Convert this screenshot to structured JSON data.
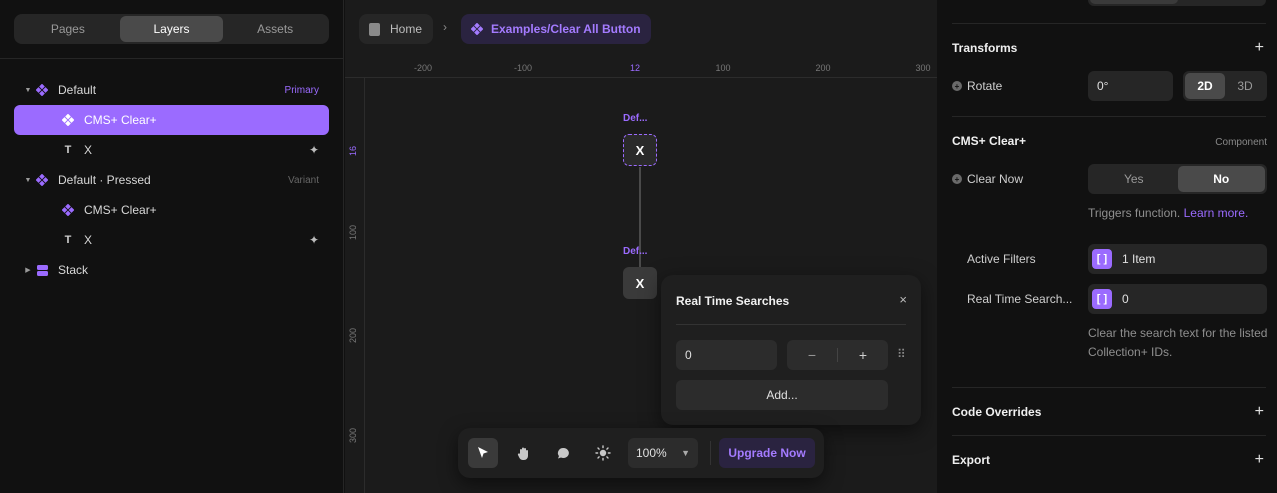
{
  "left_panel": {
    "tabs": [
      "Pages",
      "Layers",
      "Assets"
    ],
    "active_tab": "Layers",
    "layers": [
      {
        "label": "Default",
        "tag": "Primary"
      },
      {
        "label": "CMS+ Clear+"
      },
      {
        "label": "X"
      },
      {
        "label": "Default · Pressed",
        "tag": "Variant"
      },
      {
        "label": "CMS+ Clear+"
      },
      {
        "label": "X"
      },
      {
        "label": "Stack"
      }
    ]
  },
  "breadcrumb": {
    "home": "Home",
    "current": "Examples/Clear All Button"
  },
  "canvas": {
    "ruler_x": [
      "-200",
      "-100",
      "12",
      "100",
      "200",
      "300"
    ],
    "ruler_y": [
      "16",
      "100",
      "200",
      "300"
    ],
    "frame_label_1": "Def...",
    "frame_label_2": "Def...",
    "button_text_1": "X",
    "button_text_2": "X"
  },
  "popover": {
    "title": "Real Time Searches",
    "close": "×",
    "input_value": "0",
    "minus": "−",
    "plus": "+",
    "add_label": "Add..."
  },
  "toolbar": {
    "zoom": "100%",
    "upgrade": "Upgrade Now"
  },
  "right_panel": {
    "transforms_title": "Transforms",
    "rotate_label": "Rotate",
    "rotate_value": "0°",
    "mode_2d": "2D",
    "mode_3d": "3D",
    "component_title": "CMS+ Clear+",
    "component_sub": "Component",
    "clear_now_label": "Clear Now",
    "yes": "Yes",
    "no": "No",
    "triggers_text": "Triggers function.",
    "learn_more": "Learn more.",
    "active_filters_label": "Active Filters",
    "active_filters_value": "1 Item",
    "rts_label": "Real Time Search...",
    "rts_value": "0",
    "rts_hint": "Clear the search text for the listed Collection+ IDs.",
    "code_overrides": "Code Overrides",
    "export": "Export"
  },
  "colors": {
    "accent": "#9b6bff",
    "panel_bg": "#111111",
    "canvas_bg": "#1b1b1b"
  }
}
